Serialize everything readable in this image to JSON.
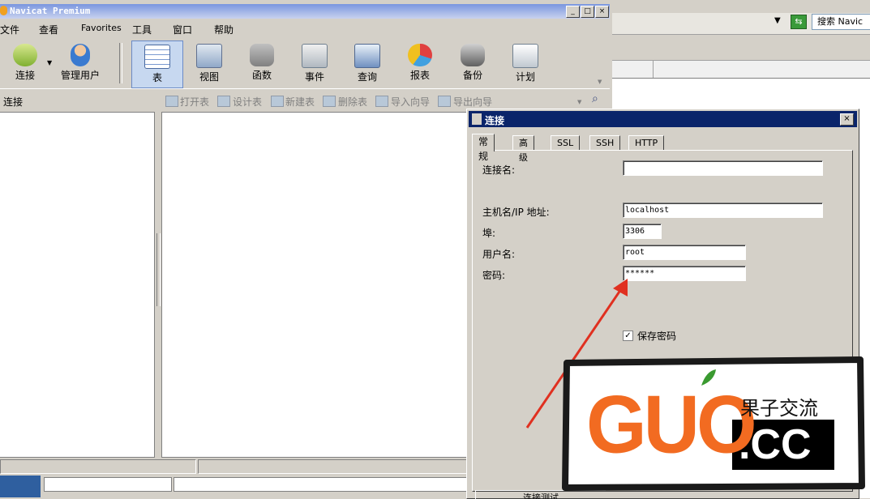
{
  "app": {
    "title": "Navicat Premium"
  },
  "window_buttons": {
    "minimize": "_",
    "maximize": "□",
    "close": "×"
  },
  "menu": [
    "文件",
    "查看",
    "Favorites",
    "工具",
    "窗口",
    "帮助"
  ],
  "toolbar": {
    "connect": "连接",
    "manage_users": "管理用户",
    "items": [
      "表",
      "视图",
      "函数",
      "事件",
      "查询",
      "报表",
      "备份",
      "计划"
    ]
  },
  "subbar": {
    "left_label": "连接",
    "actions": [
      "打开表",
      "设计表",
      "新建表",
      "删除表",
      "导入向导",
      "导出向导"
    ]
  },
  "background_window": {
    "search_label": "搜索 Navic"
  },
  "dialog": {
    "title": "连接",
    "close": "×",
    "tabs": [
      "常规",
      "高级",
      "SSL",
      "SSH",
      "HTTP"
    ],
    "fields": {
      "connection_name": {
        "label": "连接名:",
        "value": ""
      },
      "host": {
        "label": "主机名/IP 地址:",
        "value": "localhost"
      },
      "port": {
        "label": "埠:",
        "value": "3306"
      },
      "username": {
        "label": "用户名:",
        "value": "root"
      },
      "password": {
        "label": "密码:",
        "value": "******"
      }
    },
    "save_password": {
      "label": "保存密码",
      "checked": true
    },
    "test_button": "连接测试"
  },
  "watermark": {
    "logo_text": "GUO",
    "domain": ".CC",
    "tagline": "果子交流"
  },
  "colors": {
    "title_active": "#0a246a",
    "watermark_orange": "#f26b21",
    "arrow": "#e03020"
  }
}
